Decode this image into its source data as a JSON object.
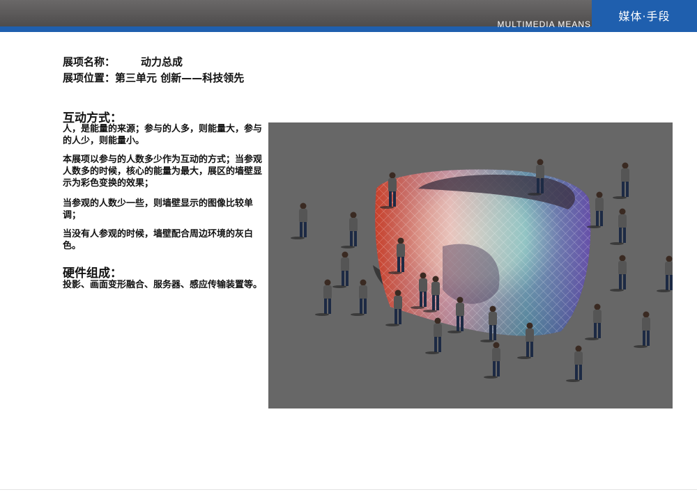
{
  "header": {
    "subtitle": "MULTIMEDIA MEANS",
    "tab_label": "媒体·手段"
  },
  "info": {
    "name_label": "展项名称：",
    "name_value": "动力总成",
    "location_label": "展项位置：",
    "location_value": "第三单元 创新——科技领先"
  },
  "interaction": {
    "title": "互动方式：",
    "paragraphs": [
      "人，是能量的来源；参与的人多，则能量大，参与的人少，则能量小。",
      "本展项以参与的人数多少作为互动的方式；当参观人数多的时候，核心的能量为最大，展区的墙壁显示为彩色变换的效果；",
      "当参观的人数少一些，则墙壁显示的图像比较单调；",
      "当没有人参观的时候，墙壁配合周边环境的灰白色。"
    ]
  },
  "hardware": {
    "title": "硬件组成：",
    "text": "投影、画面变形融合、服务器、感应传输装置等。"
  },
  "colors": {
    "header_gray": "#5a5858",
    "brand_blue": "#1f5fae",
    "figure_bg": "#676767"
  }
}
